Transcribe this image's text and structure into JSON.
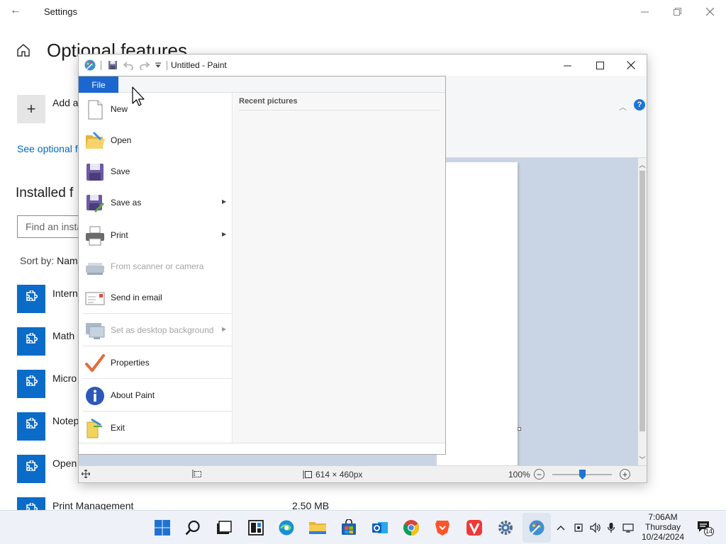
{
  "settings": {
    "window_title": "Settings",
    "heading": "Optional features",
    "add_feature_label": "Add a",
    "see_history_link": "See optional f",
    "installed_heading": "Installed f",
    "search_placeholder": "Find an insta",
    "sort_label": "Sort by:",
    "sort_value": "Nam",
    "features": [
      {
        "name": "Intern",
        "size": ""
      },
      {
        "name": "Math",
        "size": ""
      },
      {
        "name": "Micro",
        "size": ""
      },
      {
        "name": "Notep",
        "size": ""
      },
      {
        "name": "Open",
        "size": ""
      },
      {
        "name": "Print Management",
        "size": "2.50 MB"
      }
    ]
  },
  "paint": {
    "window_title": "Untitled - Paint",
    "status": {
      "canvas_size": "614 × 460px",
      "zoom": "100%"
    }
  },
  "file_menu": {
    "tab_label": "File",
    "recent_heading": "Recent pictures",
    "items": [
      {
        "label": "New",
        "icon": "new-page-icon"
      },
      {
        "label": "Open",
        "icon": "open-folder-icon"
      },
      {
        "label": "Save",
        "icon": "floppy-disk-icon"
      },
      {
        "label": "Save as",
        "icon": "save-as-icon"
      },
      {
        "label": "Print",
        "icon": "printer-icon"
      },
      {
        "label": "From scanner or camera",
        "icon": "scanner-icon"
      },
      {
        "label": "Send in email",
        "icon": "email-icon"
      },
      {
        "label": "Set as desktop background",
        "icon": "desktop-background-icon"
      },
      {
        "label": "Properties",
        "icon": "checkmark-icon"
      },
      {
        "label": "About Paint",
        "icon": "info-icon"
      },
      {
        "label": "Exit",
        "icon": "exit-folder-icon"
      }
    ]
  },
  "taskbar": {
    "time": "7:06AM",
    "day": "Thursday",
    "date": "10/24/2024",
    "notification_count": "14"
  }
}
